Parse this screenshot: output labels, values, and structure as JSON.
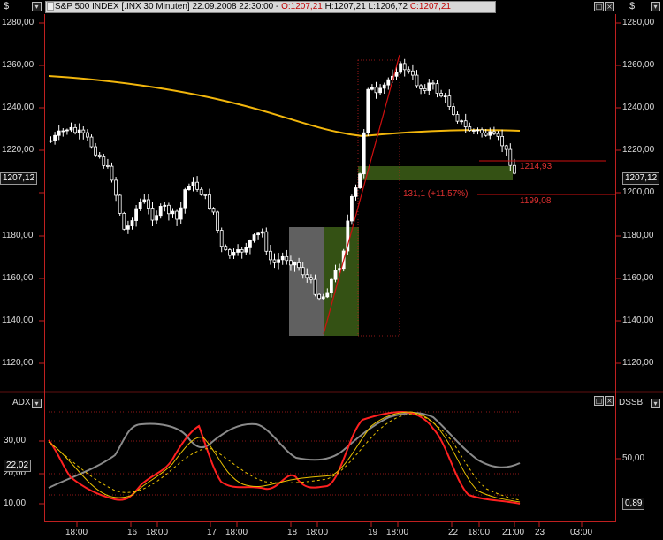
{
  "header": {
    "left_currency": "$",
    "right_currency": "$",
    "instrument": "S&P 500 INDEX [.INX  30 Minuten]",
    "timestamp": "22.09.2008 22:30:00",
    "open": "O:1207,21",
    "high": "H:1207,21",
    "low": "L:1206,72",
    "close": "C:1207,21"
  },
  "price_axis": {
    "labels": [
      "1280,00",
      "1260,00",
      "1240,00",
      "1220,00",
      "1200,00",
      "1180,00",
      "1160,00",
      "1140,00",
      "1120,00"
    ],
    "current_price": "1207,12"
  },
  "annotations": {
    "level_1": "1214,93",
    "level_2": "1199,08",
    "move": "131,1 (+11,57%)"
  },
  "indicator": {
    "left_name": "ADX",
    "right_name": "DSSB",
    "left_labels": [
      "30,00",
      "20,00",
      "10,00"
    ],
    "left_value": "22,02",
    "right_labels": [
      "50,00"
    ],
    "right_value": "0,89"
  },
  "time_axis": {
    "labels": [
      "18:00",
      "16",
      "18:00",
      "17",
      "18:00",
      "18",
      "18:00",
      "19",
      "18:00",
      "22",
      "18:00",
      "21:00",
      "23",
      "03:00"
    ]
  },
  "colors": {
    "background": "#000000",
    "candle_up": "#ffffff",
    "candle_down": "#000000",
    "ma_line": "#f2b60c",
    "trend_line": "#d01010",
    "highlight_green": "#3a5a16",
    "highlight_gray": "#808080",
    "adx_red": "#ff2020",
    "adx_gray": "#8a8a8a",
    "adx_yellow": "#e8c000"
  }
}
